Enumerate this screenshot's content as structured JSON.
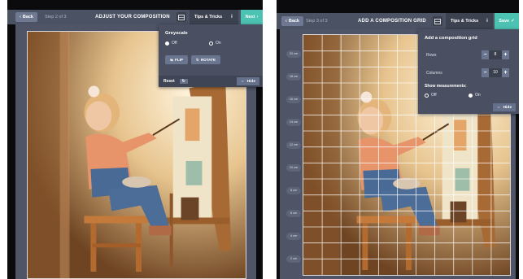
{
  "left": {
    "topbar": {
      "back_label": "Back",
      "step_label": "Step 2 of 3",
      "title": "ADJUST YOUR COMPOSITION",
      "tips_label": "Tips & Tricks",
      "next_label": "Next"
    },
    "panel": {
      "title": "Greyscale",
      "options": [
        {
          "label": "Off",
          "selected": true
        },
        {
          "label": "On",
          "selected": false
        }
      ],
      "flip_label": "FLIP",
      "rotate_label": "ROTATE",
      "reset_label": "Reset",
      "hide_label": "Hide"
    }
  },
  "right": {
    "topbar": {
      "back_label": "Back",
      "step_label": "Step 3 of 3",
      "title": "ADD A COMPOSITION GRID",
      "tips_label": "Tips & Tricks",
      "save_label": "Save"
    },
    "panel": {
      "title": "Add a composition grid",
      "rows_label": "Rows",
      "rows_value": "8",
      "columns_label": "Columns",
      "columns_value": "10",
      "measurements_label": "Show measurements:",
      "options": [
        {
          "label": "Off",
          "selected": false
        },
        {
          "label": "On",
          "selected": true
        }
      ],
      "hide_label": "Hide"
    },
    "ruler_labels": [
      "20 cm",
      "18 cm",
      "16 cm",
      "14 cm",
      "12 cm",
      "10 cm",
      "8 cm",
      "6 cm",
      "4 cm",
      "2 cm"
    ]
  },
  "colors": {
    "accent": "#4cc2b2",
    "toolbar": "#4b5263",
    "panel": "#4a5062",
    "frame": "#4f5566"
  },
  "icons": [
    "chevron-left-icon",
    "grid-icon",
    "info-icon",
    "chevron-right-icon",
    "check-icon",
    "flip-icon",
    "rotate-icon",
    "reset-icon",
    "arrows-icon"
  ]
}
